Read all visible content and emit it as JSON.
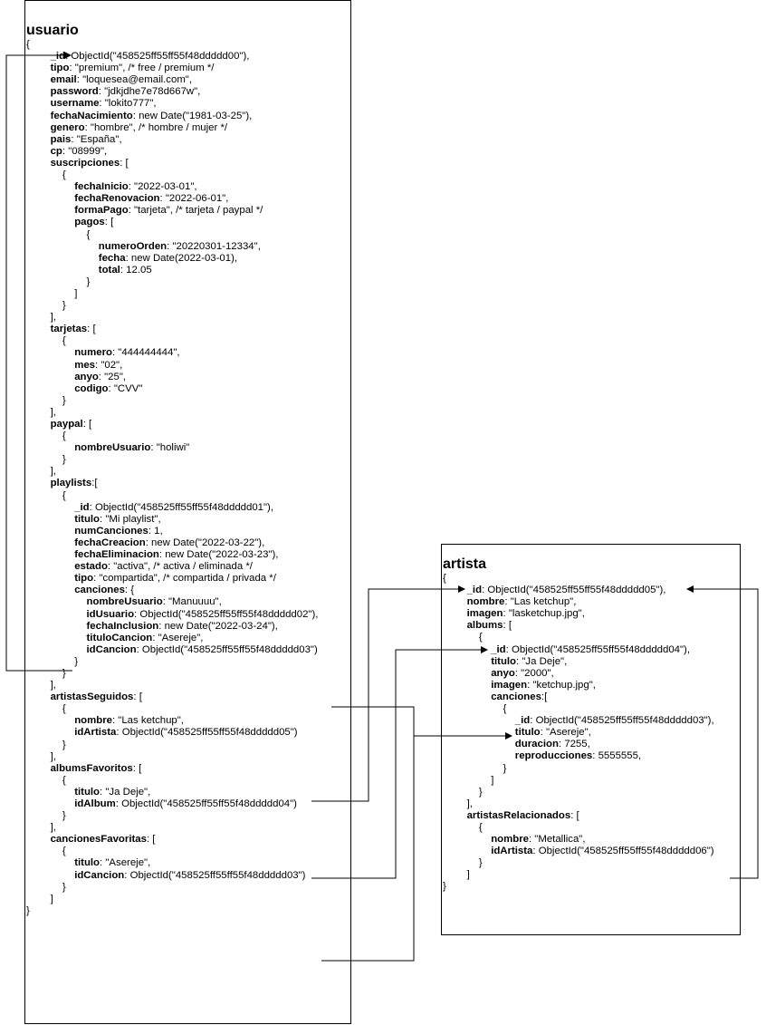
{
  "usuario": {
    "title": "usuario",
    "lines": [
      {
        "indent": 0,
        "key": "",
        "text": "{"
      },
      {
        "indent": 2,
        "key": "_id",
        "text": ": ObjectId(\"458525ff55ff55f48ddddd00\"),"
      },
      {
        "indent": 2,
        "key": "tipo",
        "text": ": \"premium\", /* free / premium */"
      },
      {
        "indent": 2,
        "key": "email",
        "text": ": \"loquesea@email.com\","
      },
      {
        "indent": 2,
        "key": "password",
        "text": ": \"jdkjdhe7e78d667w\","
      },
      {
        "indent": 2,
        "key": "username",
        "text": ": \"lokito777\","
      },
      {
        "indent": 2,
        "key": "fechaNacimiento",
        "text": ": new Date(\"1981-03-25\"),"
      },
      {
        "indent": 2,
        "key": "genero",
        "text": ": \"hombre\", /* hombre / mujer */"
      },
      {
        "indent": 2,
        "key": "pais",
        "text": ": \"España\","
      },
      {
        "indent": 2,
        "key": "cp",
        "text": ": \"08999\","
      },
      {
        "indent": 2,
        "key": "suscripciones",
        "text": ": ["
      },
      {
        "indent": 3,
        "key": "",
        "text": "{"
      },
      {
        "indent": 4,
        "key": "fechaInicio",
        "text": ": \"2022-03-01\","
      },
      {
        "indent": 4,
        "key": "fechaRenovacion",
        "text": ": \"2022-06-01\","
      },
      {
        "indent": 4,
        "key": "formaPago",
        "text": ": \"tarjeta\", /* tarjeta / paypal */"
      },
      {
        "indent": 4,
        "key": "pagos",
        "text": ": ["
      },
      {
        "indent": 5,
        "key": "",
        "text": "{"
      },
      {
        "indent": 6,
        "key": "numeroOrden",
        "text": ": \"20220301-12334\","
      },
      {
        "indent": 6,
        "key": "fecha",
        "text": ": new Date(2022-03-01),"
      },
      {
        "indent": 6,
        "key": "total",
        "text": ": 12.05"
      },
      {
        "indent": 5,
        "key": "",
        "text": "}"
      },
      {
        "indent": 4,
        "key": "",
        "text": "]"
      },
      {
        "indent": 3,
        "key": "",
        "text": "}"
      },
      {
        "indent": 2,
        "key": "",
        "text": "],"
      },
      {
        "indent": 2,
        "key": "tarjetas",
        "text": ": ["
      },
      {
        "indent": 3,
        "key": "",
        "text": "{"
      },
      {
        "indent": 4,
        "key": "numero",
        "text": ": \"444444444\","
      },
      {
        "indent": 4,
        "key": "mes",
        "text": ": \"02\","
      },
      {
        "indent": 4,
        "key": "anyo",
        "text": ": \"25\","
      },
      {
        "indent": 4,
        "key": "codigo",
        "text": ": \"CVV\""
      },
      {
        "indent": 3,
        "key": "",
        "text": "}"
      },
      {
        "indent": 2,
        "key": "",
        "text": "],"
      },
      {
        "indent": 2,
        "key": "paypal",
        "text": ": ["
      },
      {
        "indent": 3,
        "key": "",
        "text": "{"
      },
      {
        "indent": 4,
        "key": "nombreUsuario",
        "text": ": \"holiwi\""
      },
      {
        "indent": 3,
        "key": "",
        "text": "}"
      },
      {
        "indent": 2,
        "key": "",
        "text": "],"
      },
      {
        "indent": 2,
        "key": "playlists",
        "text": ":["
      },
      {
        "indent": 3,
        "key": "",
        "text": "{"
      },
      {
        "indent": 4,
        "key": "_id",
        "text": ": ObjectId(\"458525ff55ff55f48ddddd01\"),"
      },
      {
        "indent": 4,
        "key": "titulo",
        "text": ": \"Mi playlist\","
      },
      {
        "indent": 4,
        "key": "numCanciones",
        "text": ": 1,"
      },
      {
        "indent": 4,
        "key": "fechaCreacion",
        "text": ": new Date(\"2022-03-22\"),"
      },
      {
        "indent": 4,
        "key": "fechaEliminacion",
        "text": ": new Date(\"2022-03-23\"),"
      },
      {
        "indent": 4,
        "key": "estado",
        "text": ": \"activa\", /* activa / eliminada */"
      },
      {
        "indent": 4,
        "key": "tipo",
        "text": ": \"compartida\", /* compartida / privada */"
      },
      {
        "indent": 4,
        "key": "canciones",
        "text": ": {"
      },
      {
        "indent": 5,
        "key": "nombreUsuario",
        "text": ": \"Manuuuu\","
      },
      {
        "indent": 5,
        "key": "idUsuario",
        "text": ": ObjectId(\"458525ff55ff55f48ddddd02\"),"
      },
      {
        "indent": 5,
        "key": "fechaInclusion",
        "text": ": new Date(\"2022-03-24\"),"
      },
      {
        "indent": 5,
        "key": "tituloCancion",
        "text": ": \"Asereje\","
      },
      {
        "indent": 5,
        "key": "idCancion",
        "text": ": ObjectId(\"458525ff55ff55f48ddddd03\")"
      },
      {
        "indent": 4,
        "key": "",
        "text": "}"
      },
      {
        "indent": 3,
        "key": "",
        "text": "}"
      },
      {
        "indent": 2,
        "key": "",
        "text": "],"
      },
      {
        "indent": 2,
        "key": "artistasSeguidos",
        "text": ": ["
      },
      {
        "indent": 3,
        "key": "",
        "text": "{"
      },
      {
        "indent": 4,
        "key": "nombre",
        "text": ": \"Las ketchup\","
      },
      {
        "indent": 4,
        "key": "idArtista",
        "text": ": ObjectId(\"458525ff55ff55f48ddddd05\")"
      },
      {
        "indent": 3,
        "key": "",
        "text": "}"
      },
      {
        "indent": 2,
        "key": "",
        "text": "],"
      },
      {
        "indent": 2,
        "key": "albumsFavoritos",
        "text": ": ["
      },
      {
        "indent": 3,
        "key": "",
        "text": "{"
      },
      {
        "indent": 4,
        "key": "titulo",
        "text": ": \"Ja Deje\","
      },
      {
        "indent": 4,
        "key": "idAlbum",
        "text": ": ObjectId(\"458525ff55ff55f48ddddd04\")"
      },
      {
        "indent": 3,
        "key": "",
        "text": "}"
      },
      {
        "indent": 2,
        "key": "",
        "text": "],"
      },
      {
        "indent": 2,
        "key": "cancionesFavoritas",
        "text": ": ["
      },
      {
        "indent": 3,
        "key": "",
        "text": "{"
      },
      {
        "indent": 4,
        "key": "titulo",
        "text": ": \"Asereje\","
      },
      {
        "indent": 4,
        "key": "idCancion",
        "text": ": ObjectId(\"458525ff55ff55f48ddddd03\")"
      },
      {
        "indent": 3,
        "key": "",
        "text": "}"
      },
      {
        "indent": 2,
        "key": "",
        "text": "]"
      },
      {
        "indent": 0,
        "key": "",
        "text": "}"
      }
    ]
  },
  "artista": {
    "title": "artista",
    "lines": [
      {
        "indent": 0,
        "key": "",
        "text": "{"
      },
      {
        "indent": 2,
        "key": "_id",
        "text": ": ObjectId(\"458525ff55ff55f48ddddd05\"),"
      },
      {
        "indent": 2,
        "key": "nombre",
        "text": ": \"Las ketchup\","
      },
      {
        "indent": 2,
        "key": "imagen",
        "text": ": \"lasketchup.jpg\","
      },
      {
        "indent": 2,
        "key": "albums",
        "text": ": ["
      },
      {
        "indent": 3,
        "key": "",
        "text": "{"
      },
      {
        "indent": 4,
        "key": "_id",
        "text": ": ObjectId(\"458525ff55ff55f48ddddd04\"),"
      },
      {
        "indent": 4,
        "key": "titulo",
        "text": ": \"Ja Deje\","
      },
      {
        "indent": 4,
        "key": "anyo",
        "text": ": \"2000\","
      },
      {
        "indent": 4,
        "key": "imagen",
        "text": ": \"ketchup.jpg\","
      },
      {
        "indent": 4,
        "key": "canciones",
        "text": ":["
      },
      {
        "indent": 5,
        "key": "",
        "text": "{"
      },
      {
        "indent": 6,
        "key": "_id",
        "text": ": ObjectId(\"458525ff55ff55f48ddddd03\"),"
      },
      {
        "indent": 6,
        "key": "titulo",
        "text": ": \"Asereje\","
      },
      {
        "indent": 6,
        "key": "duracion",
        "text": ": 7255,"
      },
      {
        "indent": 6,
        "key": "reproducciones",
        "text": ": 5555555,"
      },
      {
        "indent": 5,
        "key": "",
        "text": "}"
      },
      {
        "indent": 4,
        "key": "",
        "text": "]"
      },
      {
        "indent": 3,
        "key": "",
        "text": "}"
      },
      {
        "indent": 2,
        "key": "",
        "text": "],"
      },
      {
        "indent": 2,
        "key": "artistasRelacionados",
        "text": ": ["
      },
      {
        "indent": 3,
        "key": "",
        "text": "{"
      },
      {
        "indent": 4,
        "key": "nombre",
        "text": ": \"Metallica\","
      },
      {
        "indent": 4,
        "key": "idArtista",
        "text": ": ObjectId(\"458525ff55ff55f48ddddd06\")"
      },
      {
        "indent": 3,
        "key": "",
        "text": "}"
      },
      {
        "indent": 2,
        "key": "",
        "text": "]"
      },
      {
        "indent": 0,
        "key": "",
        "text": "}"
      }
    ]
  }
}
